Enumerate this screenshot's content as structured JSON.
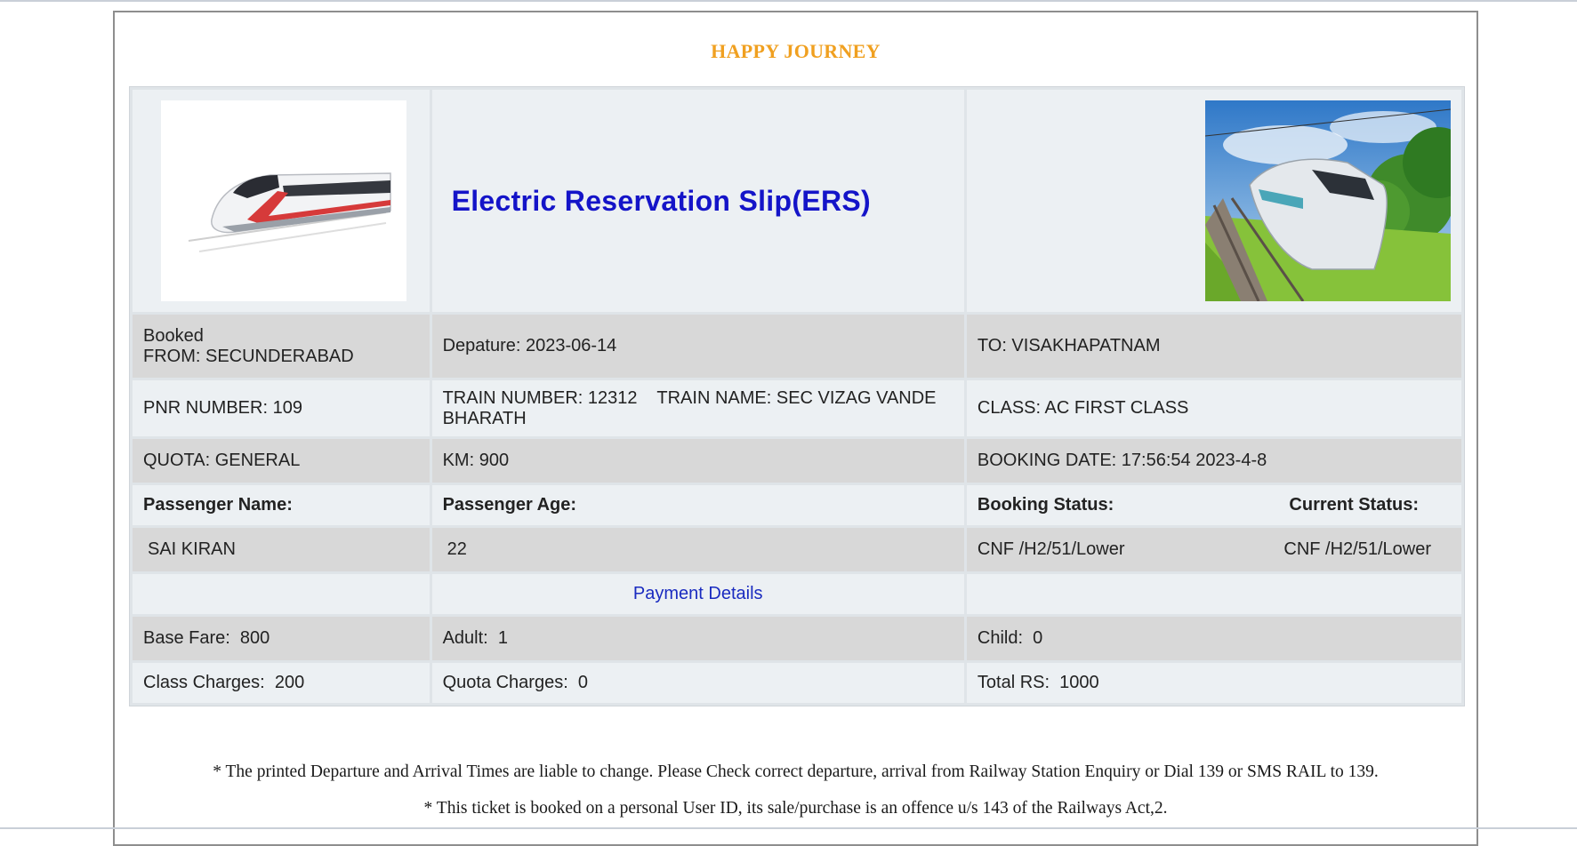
{
  "greeting": "HAPPY JOURNEY",
  "title": "Electric Reservation Slip(ERS)",
  "route": {
    "booked_label": "Booked",
    "from": "FROM: SECUNDERABAD",
    "departure": "Depature: 2023-06-14",
    "to": "TO: VISAKHAPATNAM"
  },
  "train": {
    "pnr": "PNR NUMBER: 109",
    "number_name": "TRAIN NUMBER: 12312    TRAIN NAME: SEC VIZAG VANDE BHARATH",
    "class": "CLASS: AC FIRST CLASS"
  },
  "booking": {
    "quota": "QUOTA: GENERAL",
    "km": "KM: 900",
    "date": "BOOKING DATE: 17:56:54 2023-4-8"
  },
  "passenger_headers": {
    "name": "Passenger Name:",
    "age": "Passenger Age:",
    "booking_status": "Booking Status:",
    "current_status": "Current Status:"
  },
  "passenger": {
    "name": "SAI KIRAN",
    "age": "22",
    "booking_status": "CNF /H2/51/Lower",
    "current_status": "CNF /H2/51/Lower"
  },
  "payment_heading": "Payment Details",
  "fare": {
    "base": "Base Fare:  800",
    "adult": "Adult:  1",
    "child": "Child:  0",
    "class_charges": "Class Charges:  200",
    "quota_charges": "Quota Charges:  0",
    "total": "Total RS:  1000"
  },
  "notes": [
    "* The printed Departure and Arrival Times are liable to change. Please Check correct departure, arrival from Railway Station Enquiry or Dial 139 or SMS RAIL to 139.",
    "* This ticket is booked on a personal User ID, its sale/purchase is an offence u/s 143 of the Railways Act,2."
  ],
  "icons": {
    "left_logo": "bullet-train-icon",
    "right_photo": "train-landscape-photo"
  },
  "colors": {
    "greeting": "#f0a020",
    "title": "#1414c8",
    "payment": "#1a2bc0"
  }
}
